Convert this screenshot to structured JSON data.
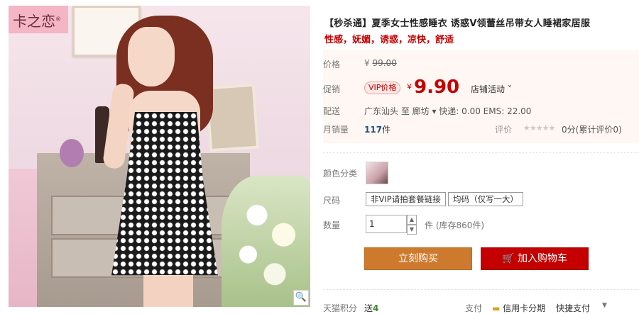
{
  "brand": "卡之恋",
  "product": {
    "title": "【秒杀通】夏季女士性感睡衣 诱惑V领蕾丝吊带女人睡裙家居服",
    "subtitle": "性感，妩媚，诱惑，凉快，舒适"
  },
  "info": {
    "price_label": "价格",
    "original_price": "99.00",
    "currency": "¥",
    "promo_label": "促销",
    "vip_badge": "VIP价格",
    "promo_price": "9.90",
    "promo_activity": "店铺活动",
    "ship_label": "配送",
    "ship_text": "广东汕头 至 廊坊 ▾ 快递: 0.00 EMS: 22.00",
    "sales_label": "月销量",
    "sales_count": "117",
    "sales_unit": "件",
    "rating_label": "评价",
    "rating_text": "0分(累计评价0)"
  },
  "options": {
    "color_label": "颜色分类",
    "size_label": "尺码",
    "size_options": [
      "非VIP请拍套餐链接",
      "均码（仅写一大）"
    ],
    "qty_label": "数量",
    "qty_value": "1",
    "qty_unit": "件 (库存860件)"
  },
  "actions": {
    "buy": "立刻购买",
    "cart": "加入购物车"
  },
  "footer": {
    "points_label": "天猫积分",
    "points_text": "送",
    "points_value": "4",
    "pay_label": "支付",
    "pay_credit": "信用卡分期",
    "pay_fast": "快捷支付"
  },
  "colors": {
    "accent": "#c40000",
    "buy_btn": "#ce7a2e",
    "info_bg": "#fff7f3"
  }
}
